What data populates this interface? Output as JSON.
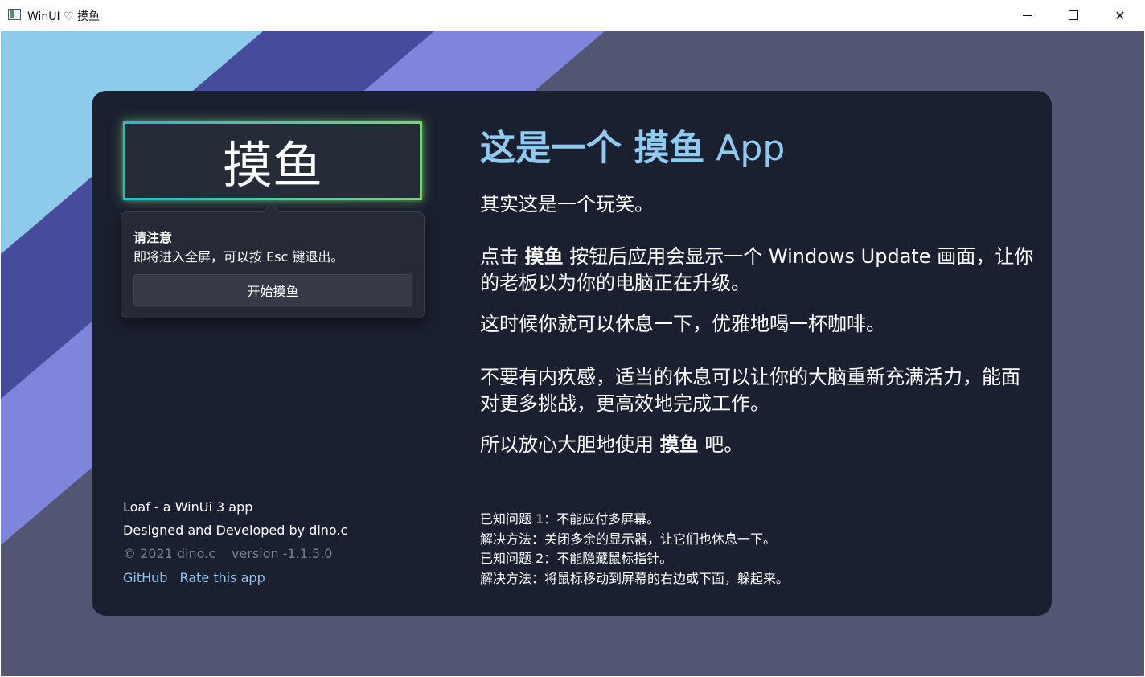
{
  "window": {
    "title": "WinUI ♡ 摸鱼",
    "min_label": "—",
    "close_label": "✕"
  },
  "background": {
    "colors": [
      "#8ecae9",
      "#474b9c",
      "#7f85dc",
      "#525672"
    ]
  },
  "sidebar": {
    "main_button_label": "摸鱼",
    "flyout": {
      "title": "请注意",
      "message": "即将进入全屏，可以按 Esc 键退出。",
      "button_label": "开始摸鱼"
    },
    "footer": {
      "line1": "Loaf - a WinUi 3 app",
      "line2": "Designed and Developed by dino.c",
      "copyright": "© 2021 dino.c",
      "version": "version -1.1.5.0",
      "link_github": "GitHub",
      "link_rate": "Rate this app"
    }
  },
  "content": {
    "heading_prefix": "这是一个 ",
    "heading_bold": "摸鱼",
    "heading_suffix": " App",
    "p1": "其实这是一个玩笑。",
    "p2_before": "点击 ",
    "p2_bold": "摸鱼",
    "p2_after": " 按钮后应用会显示一个 Windows Update 画面，让你的老板以为你的电脑正在升级。",
    "p3": "这时候你就可以休息一下，优雅地喝一杯咖啡。",
    "p4": "不要有内疚感，适当的休息可以让你的大脑重新充满活力，能面对更多挑战，更高效地完成工作。",
    "p5_before": "所以放心大胆地使用 ",
    "p5_bold": "摸鱼",
    "p5_after": " 吧。",
    "known_issues": [
      "已知问题 1：不能应付多屏幕。",
      "解决方法：关闭多余的显示器，让它们也休息一下。",
      "已知问题 2：不能隐藏鼠标指针。",
      "解决方法：将鼠标移动到屏幕的右边或下面，躲起来。"
    ]
  },
  "colors": {
    "card": "#1b2030",
    "heading": "#8fcaf0",
    "link": "#8ec6ef",
    "glow_start": "#27b7d0",
    "glow_end": "#7ed07a"
  }
}
